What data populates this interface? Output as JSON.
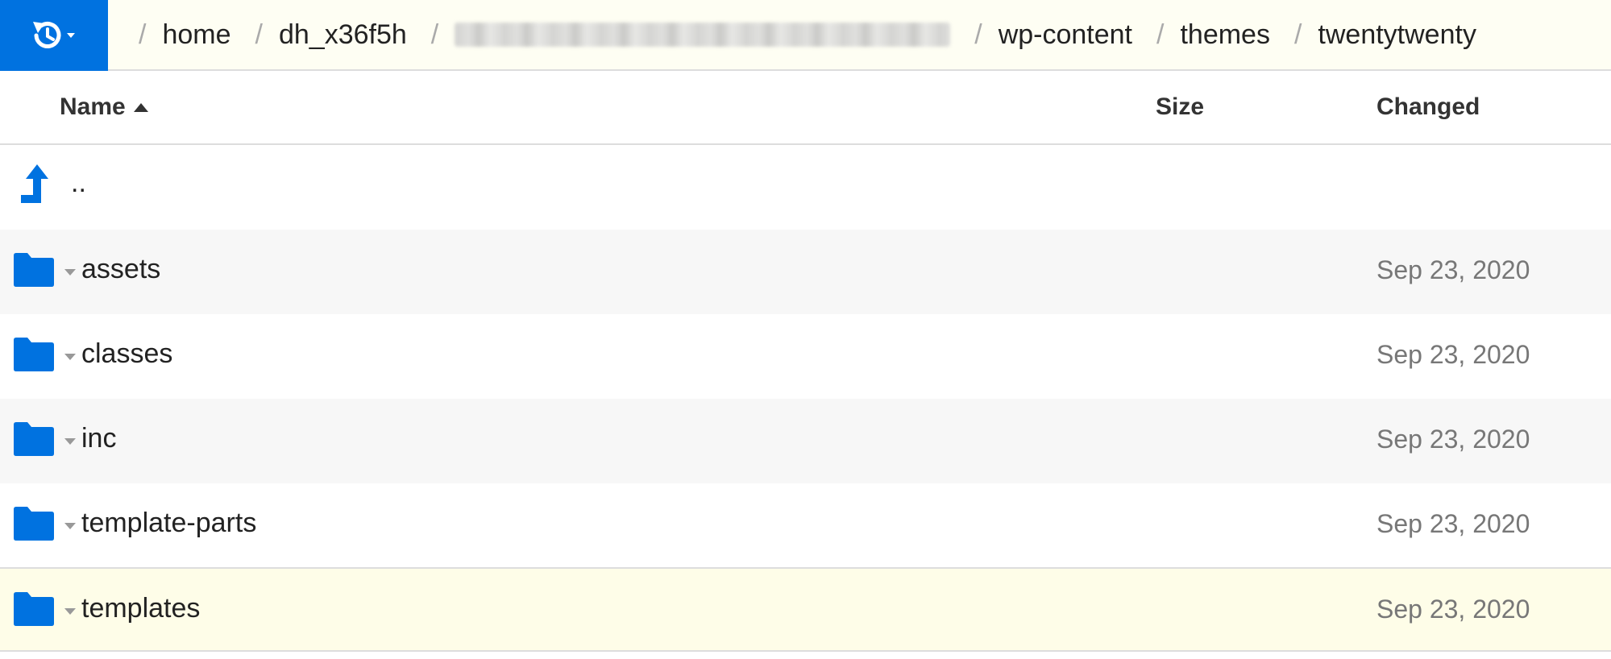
{
  "breadcrumbs": {
    "separator": "/",
    "items": [
      "home",
      "dh_x36f5h",
      "",
      "wp-content",
      "themes",
      "twentytwenty"
    ]
  },
  "columns": {
    "name": "Name",
    "size": "Size",
    "changed": "Changed"
  },
  "parent_dir": "..",
  "files": [
    {
      "name": "assets",
      "size": "",
      "changed": "Sep 23, 2020",
      "type": "folder"
    },
    {
      "name": "classes",
      "size": "",
      "changed": "Sep 23, 2020",
      "type": "folder"
    },
    {
      "name": "inc",
      "size": "",
      "changed": "Sep 23, 2020",
      "type": "folder"
    },
    {
      "name": "template-parts",
      "size": "",
      "changed": "Sep 23, 2020",
      "type": "folder"
    },
    {
      "name": "templates",
      "size": "",
      "changed": "Sep 23, 2020",
      "type": "folder",
      "selected": true
    }
  ],
  "colors": {
    "accent": "#0072e0",
    "topbar_bg": "#fefef3",
    "selected_row_bg": "#fefde8",
    "alt_row_bg": "#f7f7f7"
  },
  "icons": {
    "history_button": "history-icon",
    "parent": "level-up-icon",
    "folder": "folder-icon"
  }
}
